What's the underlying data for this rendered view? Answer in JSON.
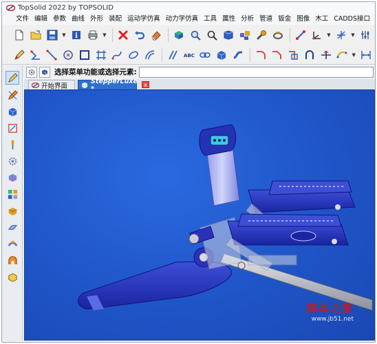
{
  "window": {
    "title": "TopSolid 2022 by TOPSOLID"
  },
  "menu": [
    {
      "label": "文件"
    },
    {
      "label": "编辑"
    },
    {
      "label": "参数"
    },
    {
      "label": "曲线"
    },
    {
      "label": "外形"
    },
    {
      "label": "装配"
    },
    {
      "label": "运动学仿真"
    },
    {
      "label": "动力学仿真"
    },
    {
      "label": "工具"
    },
    {
      "label": "属性"
    },
    {
      "label": "分析"
    },
    {
      "label": "管道"
    },
    {
      "label": "钣金"
    },
    {
      "label": "图像"
    },
    {
      "label": "木工"
    },
    {
      "label": "CADDS接口"
    }
  ],
  "prompt": {
    "label": "选择菜单功能或选择元素:",
    "value": ""
  },
  "tabs": [
    {
      "label": "开始界面",
      "active": false
    },
    {
      "label": "StepperLuxe *",
      "active": true,
      "close_label": "x"
    }
  ],
  "watermark": {
    "title": "脚本之家",
    "url": "www.jb51.net"
  },
  "colors": {
    "viewport_bg": "#1f55c8",
    "tab_active": "#2f6fd1",
    "model_blue": "#2233aa"
  }
}
